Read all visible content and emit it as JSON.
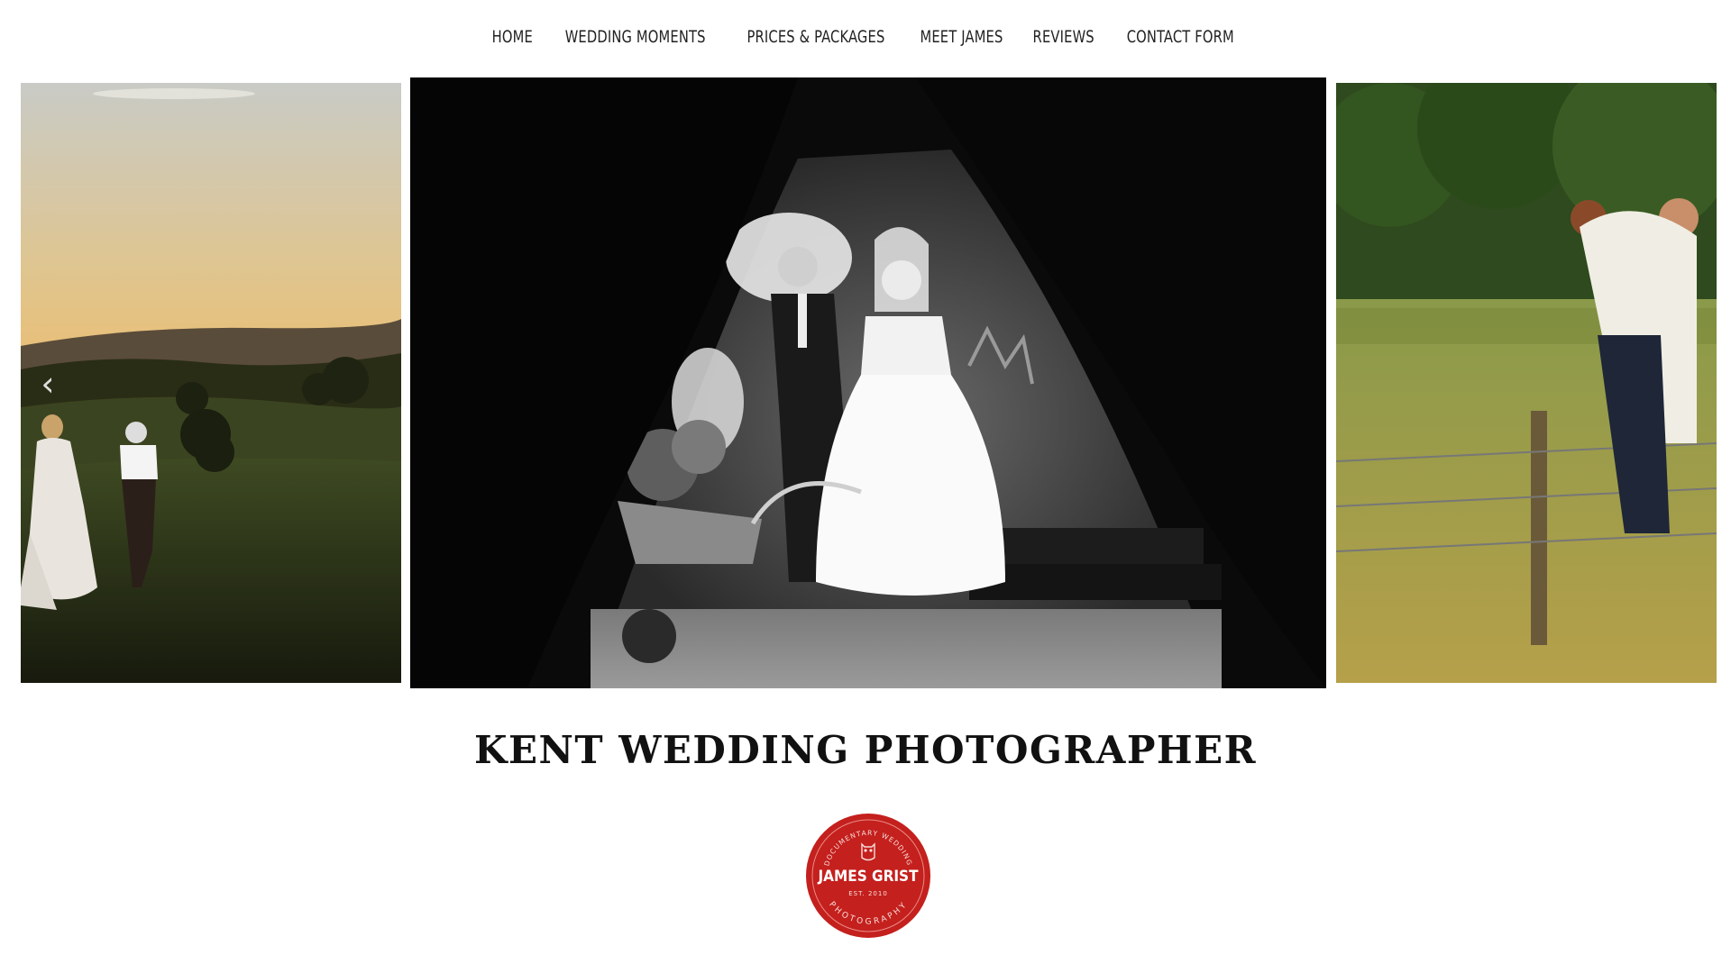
{
  "nav": {
    "items": [
      {
        "label": "HOME"
      },
      {
        "label": "WEDDING MOMENTS"
      },
      {
        "label": "PRICES & PACKAGES"
      },
      {
        "label": "MEET JAMES"
      },
      {
        "label": "REVIEWS"
      },
      {
        "label": "CONTACT FORM"
      }
    ]
  },
  "carousel": {
    "prev_icon": "chevron-left-icon"
  },
  "heading": {
    "title": "KENT WEDDING PHOTOGRAPHER"
  },
  "logo": {
    "top_arc_text": "DOCUMENTARY WEDDING",
    "name": "JAMES GRIST",
    "est": "EST. 2010",
    "bottom_arc_text": "PHOTOGRAPHY",
    "color": "#c4201d"
  }
}
